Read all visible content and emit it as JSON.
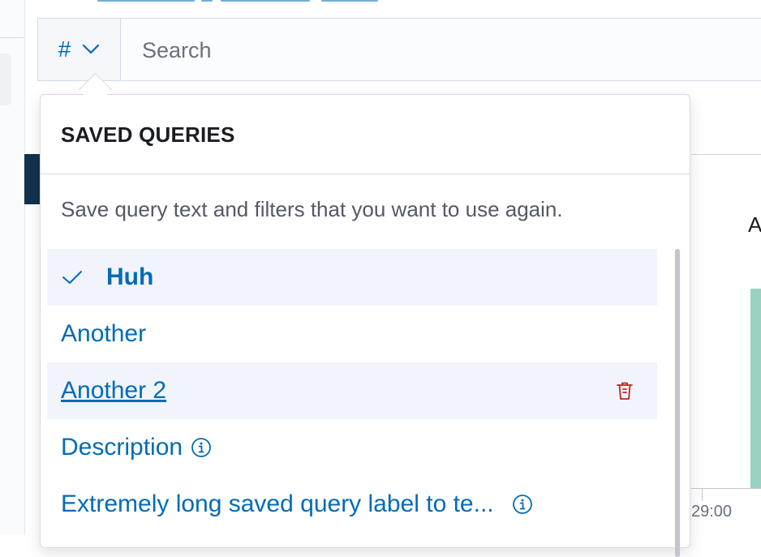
{
  "search": {
    "query_menu_label": "#",
    "placeholder": "Search"
  },
  "background": {
    "chart_label": "A",
    "axis_tick_label": "29:00"
  },
  "saved_queries": {
    "title": "SAVED QUERIES",
    "description": "Save query text and filters that you want to use again.",
    "items": [
      {
        "label": "Huh",
        "selected": true
      },
      {
        "label": "Another"
      },
      {
        "label": "Another 2",
        "hovered": true
      },
      {
        "label": "Description",
        "has_info": true
      },
      {
        "label": "Extremely long saved query label to te...",
        "has_info": true
      }
    ]
  },
  "colors": {
    "accent": "#006bb8",
    "danger": "#bd271e",
    "border": "#d3dae6"
  },
  "icons": [
    "hash-icon",
    "chevron-down-icon",
    "check-icon",
    "trash-icon",
    "info-icon"
  ]
}
